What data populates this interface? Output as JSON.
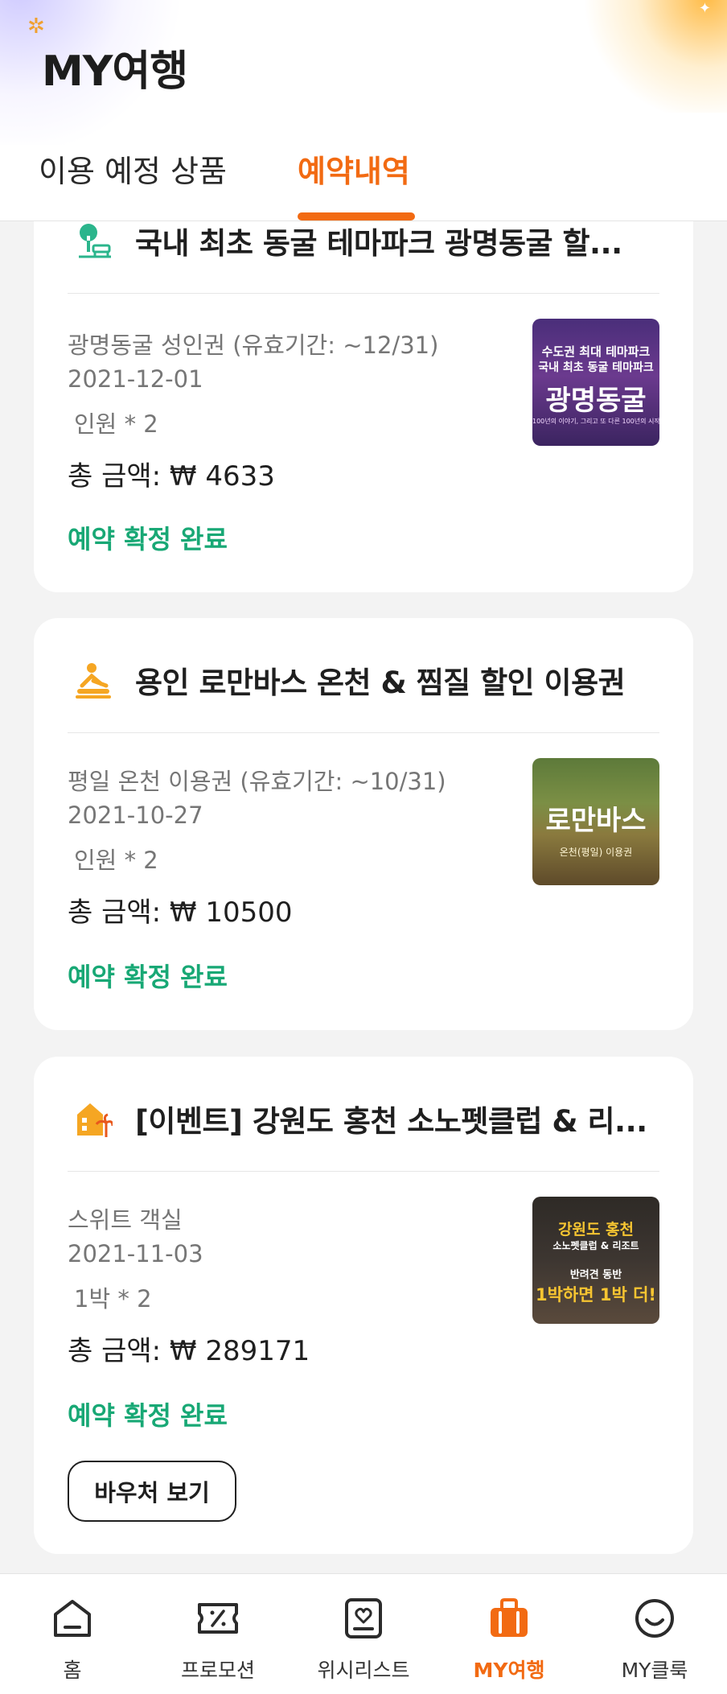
{
  "header": {
    "title": "MY여행",
    "tabs": [
      {
        "label": "이용 예정 상품",
        "active": false
      },
      {
        "label": "예약내역",
        "active": true
      }
    ]
  },
  "colors": {
    "accent": "#f26a12",
    "status_green": "#18a875",
    "background": "#f3f3f3"
  },
  "bookings": [
    {
      "category_icon": "park-icon",
      "title": "국내 최초 동굴 테마파크 광명동굴 할...",
      "option": "광명동굴 성인권 (유효기간: ~12/31)",
      "date": "2021-12-01",
      "count": "인원 * 2",
      "total": "총 금액: ₩ 4633",
      "status": "예약 확정 완료",
      "thumbnail_text": [
        "수도권 최대 테마파크",
        "국내 최초 동굴 테마파크",
        "광명동굴",
        "100년의 이야기, 그리고 또 다른 100년의 시작"
      ]
    },
    {
      "category_icon": "spa-massage-icon",
      "title": "용인 로만바스 온천 & 찜질 할인 이용권",
      "option": "평일 온천 이용권 (유효기간: ~10/31)",
      "date": "2021-10-27",
      "count": "인원 * 2",
      "total": "총 금액: ₩ 10500",
      "status": "예약 확정 완료",
      "thumbnail_text": [
        "로만바스",
        "온천(평일) 이용권"
      ]
    },
    {
      "category_icon": "resort-icon",
      "title": "[이벤트] 강원도 홍천 소노펫클럽 & 리...",
      "option": "스위트 객실",
      "date": "2021-11-03",
      "count": "1박 * 2",
      "total": "총 금액: ₩ 289171",
      "status": "예약 확정 완료",
      "thumbnail_text": [
        "강원도 홍천",
        "소노펫클럽 & 리조트",
        "반려견 동반",
        "1박하면 1박 더!"
      ],
      "voucher_button": "바우처 보기"
    }
  ],
  "bottom_nav": [
    {
      "label": "홈",
      "icon": "home-icon",
      "active": false
    },
    {
      "label": "프로모션",
      "icon": "coupon-icon",
      "active": false
    },
    {
      "label": "위시리스트",
      "icon": "wishlist-icon",
      "active": false
    },
    {
      "label": "MY여행",
      "icon": "suitcase-icon",
      "active": true
    },
    {
      "label": "MY클룩",
      "icon": "smiley-icon",
      "active": false
    }
  ]
}
